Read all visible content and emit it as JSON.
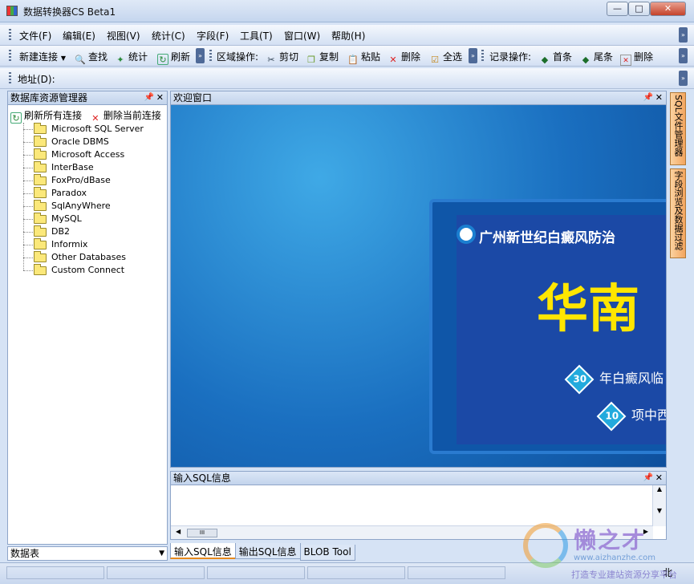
{
  "window": {
    "title": "数据转换器CS Beta1",
    "min": "—",
    "max": "□",
    "close": "✕"
  },
  "menu": [
    "文件(F)",
    "编辑(E)",
    "视图(V)",
    "统计(C)",
    "字段(F)",
    "工具(T)",
    "窗口(W)",
    "帮助(H)"
  ],
  "toolbar": {
    "new_connection": "新建连接",
    "find": "查找",
    "stats": "统计",
    "refresh": "刷新",
    "region_ops": "区域操作:",
    "cut": "剪切",
    "copy": "复制",
    "paste": "粘贴",
    "delete": "删除",
    "select_all": "全选",
    "record_ops": "记录操作:",
    "first": "首条",
    "last": "尾条",
    "record_delete": "删除"
  },
  "address": {
    "label": "地址(D):"
  },
  "left_panel": {
    "title": "数据库资源管理器",
    "refresh_all": "刷新所有连接",
    "delete_current": "删除当前连接",
    "tree": [
      "Microsoft SQL Server",
      "Oracle DBMS",
      "Microsoft Access",
      "InterBase",
      "FoxPro/dBase",
      "Paradox",
      "SqlAnyWhere",
      "MySQL",
      "DB2",
      "Informix",
      "Other Databases",
      "Custom Connect"
    ],
    "select_value": "数据表"
  },
  "welcome": {
    "title": "欢迎窗口",
    "banner_title": "广州新世纪白癜风防治",
    "banner_big": "华南",
    "row1_num": "30",
    "row1_text": "年白癜风临",
    "row2_num": "10",
    "row2_text": "项中西"
  },
  "sql_panel": {
    "title": "输入SQL信息",
    "scroll_thumb": "III"
  },
  "tabs": [
    "输入SQL信息",
    "输出SQL信息",
    "BLOB Tool"
  ],
  "side_tabs": [
    "SQL文件管理器",
    "字段浏览及数据过滤"
  ],
  "status": {
    "pos": "北"
  },
  "watermark": {
    "main": "懒之才",
    "url": "www.aizhanzhe.com",
    "sub": "打造专业建站资源分享平台"
  }
}
